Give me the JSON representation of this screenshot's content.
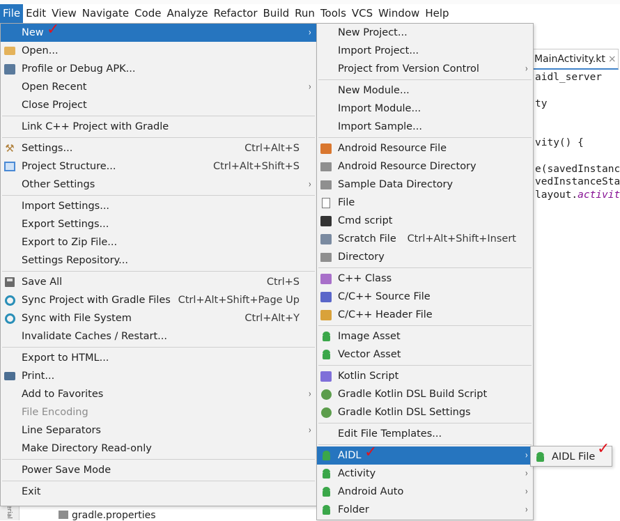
{
  "menubar": [
    "File",
    "Edit",
    "View",
    "Navigate",
    "Code",
    "Analyze",
    "Refactor",
    "Build",
    "Run",
    "Tools",
    "VCS",
    "Window",
    "Help"
  ],
  "editor": {
    "tab_label": "MainActivity.kt",
    "tab_close": "×",
    "code_lines": [
      "aidl_server",
      "ty",
      "vity() {",
      "e(savedInstance",
      "vedInstanceSta",
      "layout."
    ],
    "code_accent": "activit"
  },
  "tree_item": "gradle.properties",
  "left_gutter": "erial",
  "file_menu": [
    {
      "label": "New",
      "shortcut": "",
      "submenu": true,
      "selected": true,
      "icon": ""
    },
    {
      "label": "Open...",
      "icon": "folder-open-icon"
    },
    {
      "label": "Profile or Debug APK...",
      "icon": "apk-icon"
    },
    {
      "label": "Open Recent",
      "submenu": true
    },
    {
      "label": "Close Project"
    },
    {
      "sep": true
    },
    {
      "label": "Link C++ Project with Gradle"
    },
    {
      "sep": true
    },
    {
      "label": "Settings...",
      "shortcut": "Ctrl+Alt+S",
      "icon": "wrench-icon"
    },
    {
      "label": "Project Structure...",
      "shortcut": "Ctrl+Alt+Shift+S",
      "icon": "project-structure-icon"
    },
    {
      "label": "Other Settings",
      "submenu": true
    },
    {
      "sep": true
    },
    {
      "label": "Import Settings..."
    },
    {
      "label": "Export Settings..."
    },
    {
      "label": "Export to Zip File..."
    },
    {
      "label": "Settings Repository..."
    },
    {
      "sep": true
    },
    {
      "label": "Save All",
      "shortcut": "Ctrl+S",
      "icon": "save-icon"
    },
    {
      "label": "Sync Project with Gradle Files",
      "shortcut": "Ctrl+Alt+Shift+Page Up",
      "icon": "gradle-sync-icon"
    },
    {
      "label": "Sync with File System",
      "shortcut": "Ctrl+Alt+Y",
      "icon": "refresh-icon"
    },
    {
      "label": "Invalidate Caches / Restart..."
    },
    {
      "sep": true
    },
    {
      "label": "Export to HTML..."
    },
    {
      "label": "Print...",
      "icon": "printer-icon"
    },
    {
      "label": "Add to Favorites",
      "submenu": true
    },
    {
      "label": "File Encoding",
      "disabled": true
    },
    {
      "label": "Line Separators",
      "submenu": true
    },
    {
      "label": "Make Directory Read-only"
    },
    {
      "sep": true
    },
    {
      "label": "Power Save Mode"
    },
    {
      "sep": true
    },
    {
      "label": "Exit"
    }
  ],
  "new_menu": [
    {
      "label": "New Project..."
    },
    {
      "label": "Import Project..."
    },
    {
      "label": "Project from Version Control",
      "submenu": true
    },
    {
      "sep": true
    },
    {
      "label": "New Module..."
    },
    {
      "label": "Import Module..."
    },
    {
      "label": "Import Sample..."
    },
    {
      "sep": true
    },
    {
      "label": "Android Resource File",
      "icon": "resource-file-icon"
    },
    {
      "label": "Android Resource Directory",
      "icon": "folder-icon"
    },
    {
      "label": "Sample Data Directory",
      "icon": "folder-icon"
    },
    {
      "label": "File",
      "icon": "file-icon"
    },
    {
      "label": "Cmd script",
      "icon": "cmd-icon"
    },
    {
      "label": "Scratch File",
      "shortcut": "Ctrl+Alt+Shift+Insert",
      "icon": "scratch-file-icon"
    },
    {
      "label": "Directory",
      "icon": "folder-icon"
    },
    {
      "sep": true
    },
    {
      "label": "C++ Class",
      "icon": "cpp-class-icon"
    },
    {
      "label": "C/C++ Source File",
      "icon": "cpp-source-icon"
    },
    {
      "label": "C/C++ Header File",
      "icon": "cpp-header-icon"
    },
    {
      "sep": true
    },
    {
      "label": "Image Asset",
      "icon": "android-icon"
    },
    {
      "label": "Vector Asset",
      "icon": "android-icon"
    },
    {
      "sep": true
    },
    {
      "label": "Kotlin Script",
      "icon": "kotlin-icon"
    },
    {
      "label": "Gradle Kotlin DSL Build Script",
      "icon": "gradle-icon"
    },
    {
      "label": "Gradle Kotlin DSL Settings",
      "icon": "gradle-icon"
    },
    {
      "sep": true
    },
    {
      "label": "Edit File Templates..."
    },
    {
      "sep": true
    },
    {
      "label": "AIDL",
      "submenu": true,
      "selected": true,
      "icon": "android-icon"
    },
    {
      "label": "Activity",
      "submenu": true,
      "icon": "android-icon"
    },
    {
      "label": "Android Auto",
      "submenu": true,
      "icon": "android-icon"
    },
    {
      "label": "Folder",
      "submenu": true,
      "icon": "android-icon"
    }
  ],
  "aidl_menu": [
    {
      "label": "AIDL File",
      "icon": "aidl-file-icon"
    }
  ],
  "glyphs": {
    "arrow": "›",
    "check": "✓"
  },
  "colors": {
    "selection": "#2675bf",
    "menu_bg": "#f2f2f2",
    "check": "#e0141e",
    "android": "#3ba74a"
  }
}
